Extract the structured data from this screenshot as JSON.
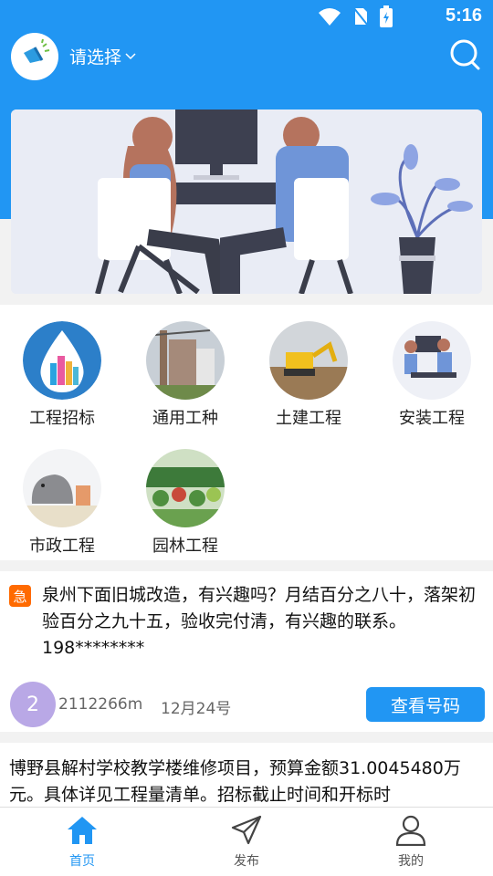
{
  "status_bar": {
    "time": "5:16"
  },
  "header": {
    "location_label": "请选择"
  },
  "categories": [
    {
      "label": "工程招标"
    },
    {
      "label": "通用工种"
    },
    {
      "label": "土建工程"
    },
    {
      "label": "安装工程"
    },
    {
      "label": "市政工程"
    },
    {
      "label": "园林工程"
    }
  ],
  "posts": [
    {
      "badge": "急",
      "text": "泉州下面旧城改造，有兴趣吗？月结百分之八十，落架初验百分之九十五，验收完付清，有兴趣的联系。198********",
      "avatar_text": "2",
      "user_id": "2112266m",
      "date": "12月24号",
      "action_label": "查看号码"
    },
    {
      "text": "博野县解村学校教学楼维修项目，预算金额31.0045480万元。具体详见工程量清单。招标截止时间和开标时"
    }
  ],
  "tabs": [
    {
      "label": "首页"
    },
    {
      "label": "发布"
    },
    {
      "label": "我的"
    }
  ],
  "colors": {
    "primary": "#2196F3",
    "urgent": "#ff6a00",
    "avatar": "#b9a8e6"
  }
}
